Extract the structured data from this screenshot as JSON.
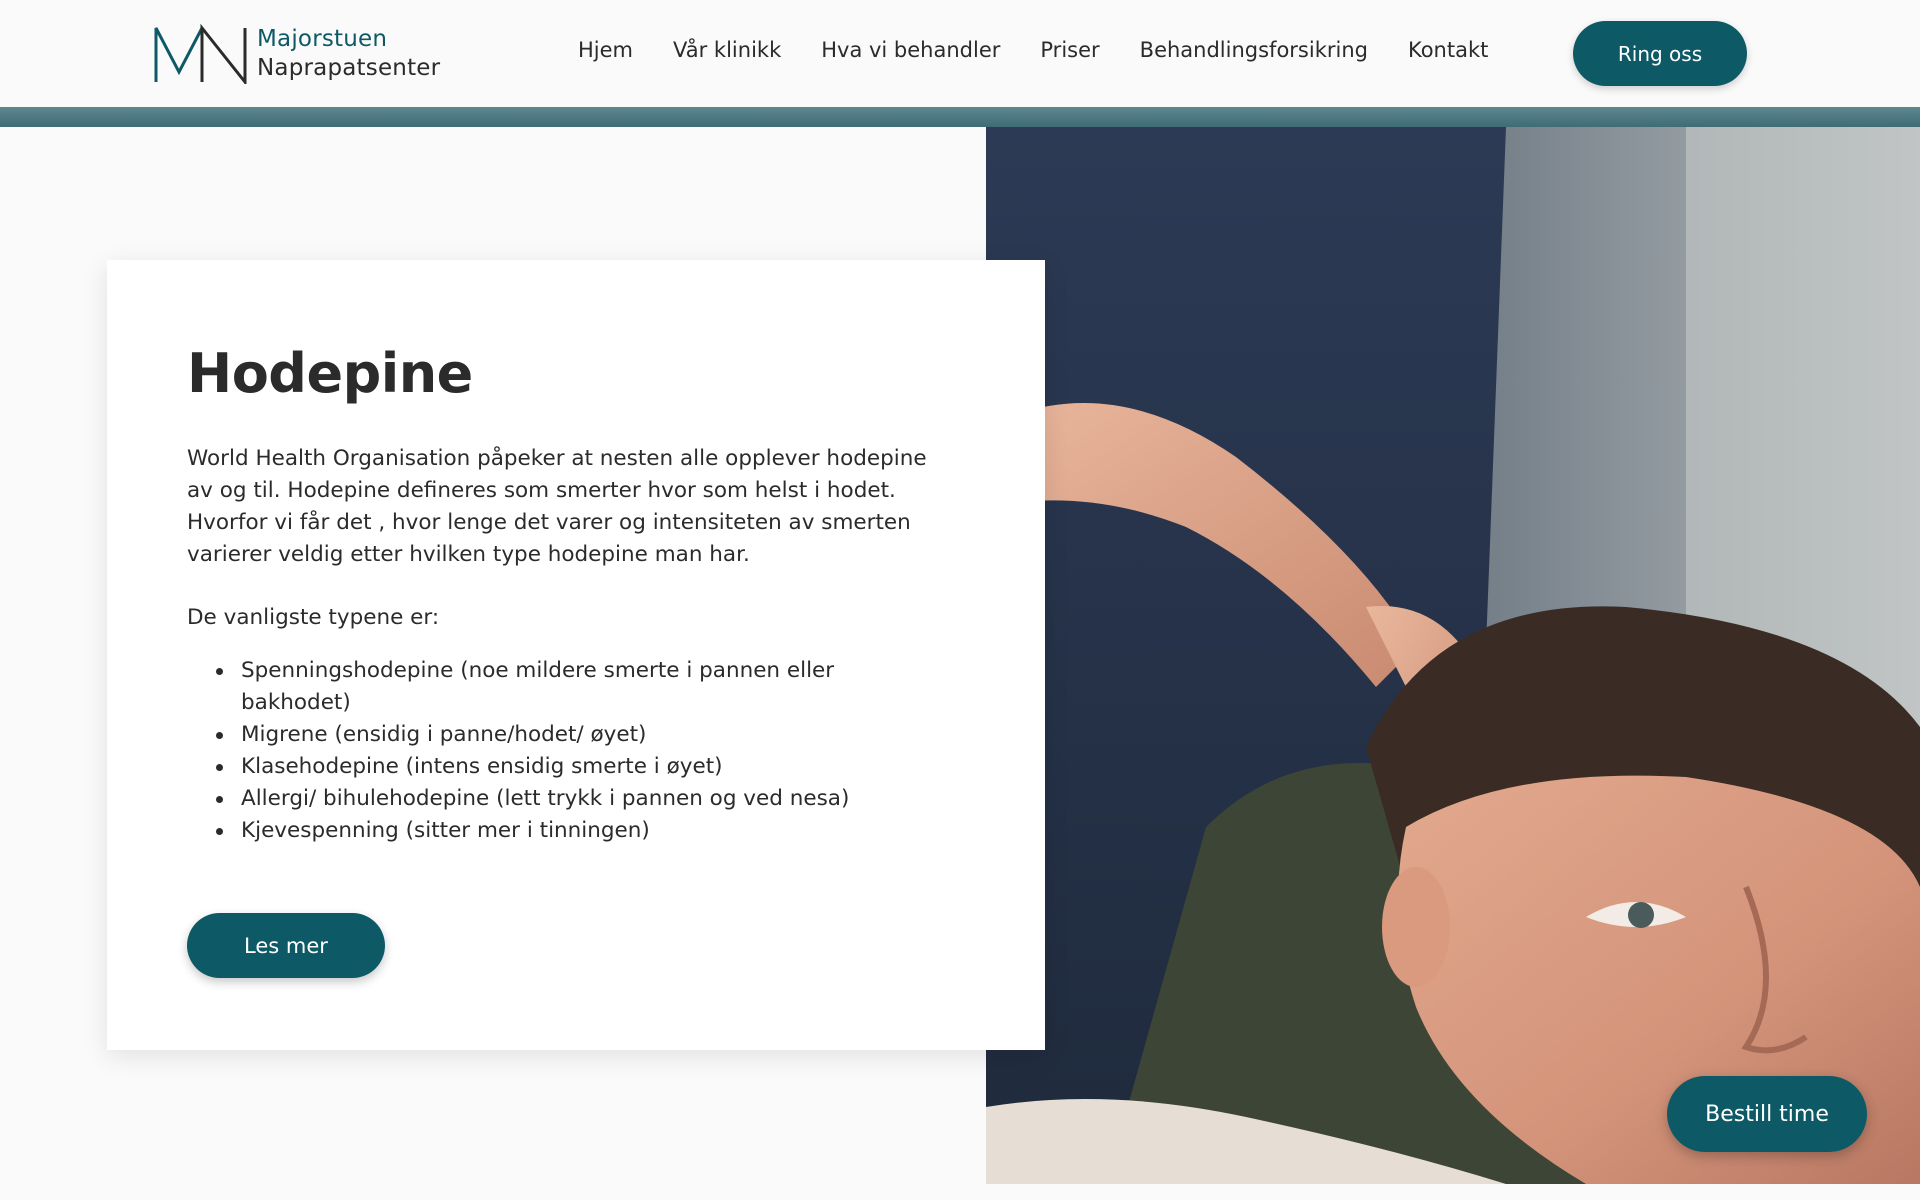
{
  "header": {
    "logo": {
      "mark": "MN",
      "line1": "Majorstuen",
      "line2": "Naprapatsenter"
    },
    "nav": [
      {
        "label": "Hjem"
      },
      {
        "label": "Vår klinikk"
      },
      {
        "label": "Hva vi behandler"
      },
      {
        "label": "Priser"
      },
      {
        "label": "Behandlingsforsikring"
      },
      {
        "label": "Kontakt"
      }
    ],
    "call_button": "Ring oss"
  },
  "card": {
    "title": "Hodepine",
    "intro": "World Health Organisation påpeker at nesten alle opplever hodepine av og til. Hodepine defineres som smerter hvor som helst i hodet. Hvorfor vi får det , hvor lenge det varer og intensiteten av smerten varierer veldig etter hvilken type hodepine man har.",
    "subhead": "De vanligste typene er:",
    "types": [
      "Spenningshodepine (noe mildere smerte i pannen eller bakhodet)",
      "Migrene (ensidig i panne/hodet/ øyet)",
      "Klasehodepine (intens ensidig smerte i øyet)",
      "Allergi/ bihulehodepine (lett trykk i pannen og ved nesa)",
      "Kjevespenning (sitter mer i tinningen)"
    ],
    "more_button": "Les mer"
  },
  "book_button": "Bestill time",
  "colors": {
    "brand": "#0d5a66",
    "header_bar": "#4a737c",
    "text": "#2b2b2b",
    "background": "#fafafa",
    "card": "#ffffff"
  },
  "icons": {
    "logo": "mn-monogram-icon",
    "hero": "neck-treatment-photo"
  }
}
